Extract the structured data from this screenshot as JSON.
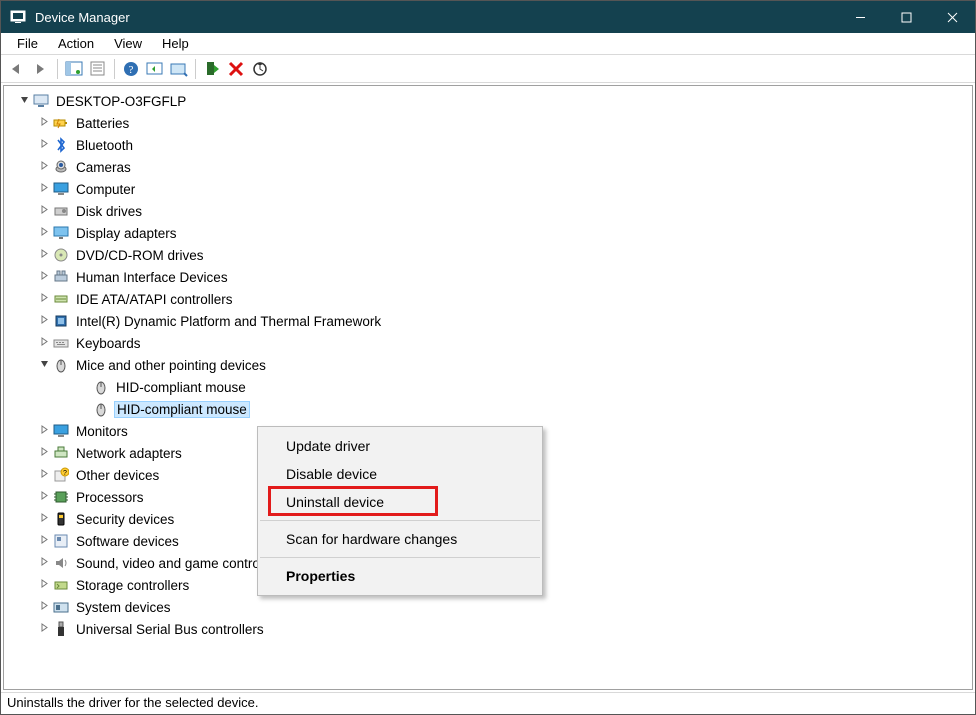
{
  "window": {
    "title": "Device Manager"
  },
  "menu": {
    "file": "File",
    "action": "Action",
    "view": "View",
    "help": "Help"
  },
  "tree": {
    "root": "DESKTOP-O3FGFLP",
    "categories": [
      {
        "label": "Batteries",
        "icon": "battery"
      },
      {
        "label": "Bluetooth",
        "icon": "bluetooth"
      },
      {
        "label": "Cameras",
        "icon": "camera"
      },
      {
        "label": "Computer",
        "icon": "monitor"
      },
      {
        "label": "Disk drives",
        "icon": "disk"
      },
      {
        "label": "Display adapters",
        "icon": "display"
      },
      {
        "label": "DVD/CD-ROM drives",
        "icon": "cdrom"
      },
      {
        "label": "Human Interface Devices",
        "icon": "hid"
      },
      {
        "label": "IDE ATA/ATAPI controllers",
        "icon": "ide"
      },
      {
        "label": "Intel(R) Dynamic Platform and Thermal Framework",
        "icon": "chip"
      },
      {
        "label": "Keyboards",
        "icon": "keyboard"
      },
      {
        "label": "Mice and other pointing devices",
        "icon": "mouse",
        "expanded": true,
        "children": [
          {
            "label": "HID-compliant mouse",
            "icon": "mouse"
          },
          {
            "label": "HID-compliant mouse",
            "icon": "mouse",
            "selected": true
          }
        ]
      },
      {
        "label": "Monitors",
        "icon": "monitor"
      },
      {
        "label": "Network adapters",
        "icon": "network"
      },
      {
        "label": "Other devices",
        "icon": "other"
      },
      {
        "label": "Processors",
        "icon": "cpu"
      },
      {
        "label": "Security devices",
        "icon": "security"
      },
      {
        "label": "Software devices",
        "icon": "software"
      },
      {
        "label": "Sound, video and game controllers",
        "icon": "sound"
      },
      {
        "label": "Storage controllers",
        "icon": "storage"
      },
      {
        "label": "System devices",
        "icon": "system"
      },
      {
        "label": "Universal Serial Bus controllers",
        "icon": "usb"
      }
    ]
  },
  "context_menu": {
    "update": "Update driver",
    "disable": "Disable device",
    "uninstall": "Uninstall device",
    "scan": "Scan for hardware changes",
    "properties": "Properties"
  },
  "statusbar": "Uninstalls the driver for the selected device.",
  "highlight_item": "uninstall"
}
